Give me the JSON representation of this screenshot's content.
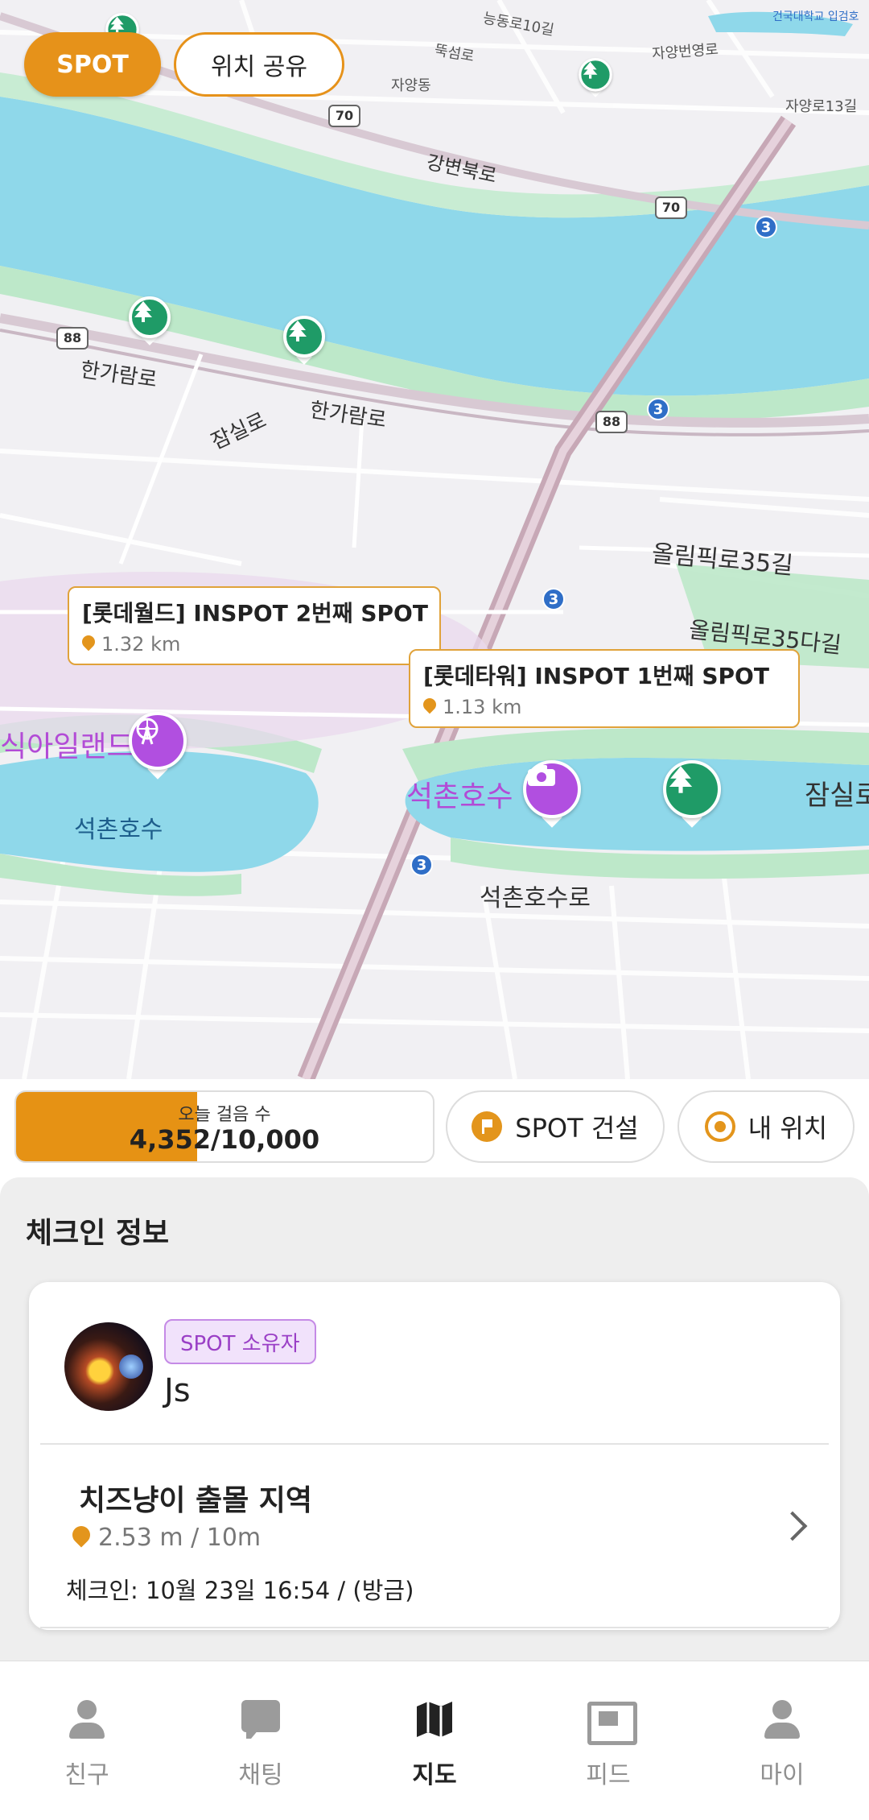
{
  "top_buttons": {
    "spot": "SPOT",
    "share": "위치 공유"
  },
  "map": {
    "road_labels": [
      "능동로10길",
      "뚝섬로",
      "자양번영로",
      "자양로13길",
      "강변북로",
      "한가람로",
      "잠실로",
      "한가람로",
      "올림픽로35길",
      "올림픽로35다길",
      "석촌호수로",
      "잠실로",
      "자양동",
      "건국대학교 입검호"
    ],
    "water_labels": [
      "석촌호수",
      "석촌호수"
    ],
    "poi_labels": [
      "식아일랜드"
    ],
    "route_numbers": [
      "3",
      "3",
      "3",
      "3"
    ],
    "highway_numbers": [
      "70",
      "70",
      "88",
      "88"
    ],
    "callouts": [
      {
        "title": "[롯데월드] INSPOT 2번째 SPOT",
        "distance": "1.32 km"
      },
      {
        "title": "[롯데타워] INSPOT 1번째 SPOT",
        "distance": "1.13 km"
      }
    ]
  },
  "steps": {
    "label": "오늘 걸음 수",
    "value": "4,352/10,000",
    "progress": 0.4352
  },
  "controls": {
    "build": "SPOT 건설",
    "my_location": "내 위치"
  },
  "checkin": {
    "title": "체크인 정보",
    "badge": "SPOT 소유자",
    "username": "Js",
    "location_name": "치즈냥이 출몰 지역",
    "distance": "2.53 m / 10m",
    "time": "체크인: 10월 23일 16:54 / (방금)"
  },
  "nav": [
    {
      "label": "친구",
      "icon": "friends-icon",
      "active": false
    },
    {
      "label": "채팅",
      "icon": "chat-icon",
      "active": false
    },
    {
      "label": "지도",
      "icon": "map-icon",
      "active": true
    },
    {
      "label": "피드",
      "icon": "feed-icon",
      "active": false
    },
    {
      "label": "마이",
      "icon": "profile-icon",
      "active": false
    }
  ],
  "colors": {
    "accent": "#e6921a",
    "water": "#8fd8ea",
    "park": "#bde8c9",
    "badge_purple": "#9a3fc6"
  }
}
